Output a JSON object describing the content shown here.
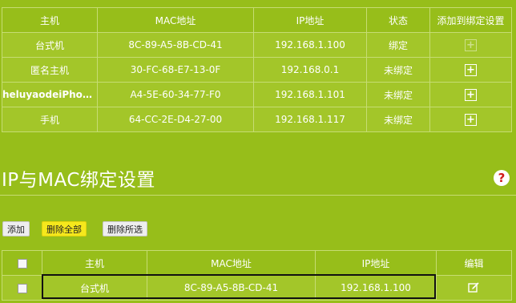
{
  "arp_table": {
    "headers": [
      "主机",
      "MAC地址",
      "IP地址",
      "状态",
      "添加到绑定设置"
    ],
    "rows": [
      {
        "host": "台式机",
        "mac": "8C-89-A5-8B-CD-41",
        "ip": "192.168.1.100",
        "status": "绑定",
        "add": "+"
      },
      {
        "host": "匿名主机",
        "mac": "30-FC-68-E7-13-0F",
        "ip": "192.168.0.1",
        "status": "未绑定",
        "add": "+"
      },
      {
        "host": "heluyaodeiPhon...",
        "mac": "A4-5E-60-34-77-F0",
        "ip": "192.168.1.101",
        "status": "未绑定",
        "add": "+"
      },
      {
        "host": "手机",
        "mac": "64-CC-2E-D4-27-00",
        "ip": "192.168.1.117",
        "status": "未绑定",
        "add": "+"
      }
    ]
  },
  "section": {
    "title": "IP与MAC绑定设置",
    "help": "?"
  },
  "toolbar": {
    "add_label": "添加",
    "delete_all_label": "删除全部",
    "delete_selected_label": "删除所选"
  },
  "binding_table": {
    "headers": [
      "",
      "主机",
      "MAC地址",
      "IP地址",
      "编辑"
    ],
    "rows": [
      {
        "host": "台式机",
        "mac": "8C-89-A5-8B-CD-41",
        "ip": "192.168.1.100"
      }
    ]
  },
  "colors": {
    "background": "#97be1a",
    "row": "#a3c629",
    "delete_all_button": "#f6e81c",
    "help_icon": "#d01818"
  },
  "icons": {
    "add": "plus-box-icon",
    "edit": "edit-pencil-icon",
    "help": "question-circle-icon"
  }
}
